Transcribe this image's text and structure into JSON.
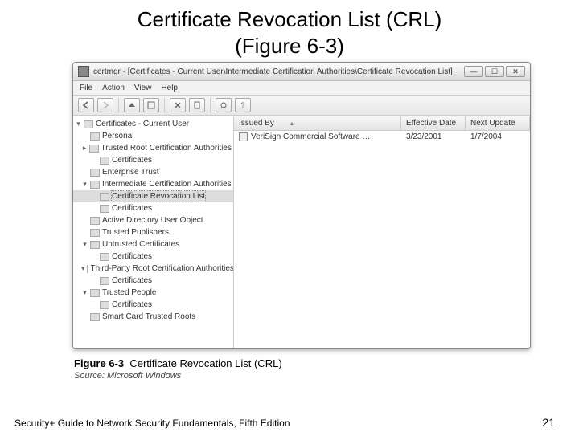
{
  "slide": {
    "title_line1": "Certificate Revocation List (CRL)",
    "title_line2": "(Figure 6-3)",
    "footer_left": "Security+ Guide to Network Security Fundamentals, Fifth Edition",
    "page_number": "21"
  },
  "caption": {
    "label": "Figure 6-3",
    "text": "Certificate Revocation List (CRL)",
    "source": "Source: Microsoft Windows"
  },
  "window": {
    "title": "certmgr - [Certificates - Current User\\Intermediate Certification Authorities\\Certificate Revocation List]",
    "menu": [
      "File",
      "Action",
      "View",
      "Help"
    ],
    "tree": [
      {
        "depth": 0,
        "tw": "▾",
        "label": "Certificates - Current User"
      },
      {
        "depth": 1,
        "tw": "",
        "label": "Personal"
      },
      {
        "depth": 1,
        "tw": "▸",
        "label": "Trusted Root Certification Authorities"
      },
      {
        "depth": 2,
        "tw": "",
        "label": "Certificates"
      },
      {
        "depth": 1,
        "tw": "",
        "label": "Enterprise Trust"
      },
      {
        "depth": 1,
        "tw": "▾",
        "label": "Intermediate Certification Authorities"
      },
      {
        "depth": 2,
        "tw": "",
        "label": "Certificate Revocation List",
        "selected": true
      },
      {
        "depth": 2,
        "tw": "",
        "label": "Certificates"
      },
      {
        "depth": 1,
        "tw": "",
        "label": "Active Directory User Object"
      },
      {
        "depth": 1,
        "tw": "",
        "label": "Trusted Publishers"
      },
      {
        "depth": 1,
        "tw": "▾",
        "label": "Untrusted Certificates"
      },
      {
        "depth": 2,
        "tw": "",
        "label": "Certificates"
      },
      {
        "depth": 1,
        "tw": "▾",
        "label": "Third-Party Root Certification Authorities"
      },
      {
        "depth": 2,
        "tw": "",
        "label": "Certificates"
      },
      {
        "depth": 1,
        "tw": "▾",
        "label": "Trusted People"
      },
      {
        "depth": 2,
        "tw": "",
        "label": "Certificates"
      },
      {
        "depth": 1,
        "tw": "",
        "label": "Smart Card Trusted Roots"
      }
    ],
    "columns": [
      "Issued By",
      "Effective Date",
      "Next Update"
    ],
    "rows": [
      {
        "issued_by": "VeriSign Commercial Software …",
        "effective": "3/23/2001",
        "next": "1/7/2004"
      }
    ]
  }
}
